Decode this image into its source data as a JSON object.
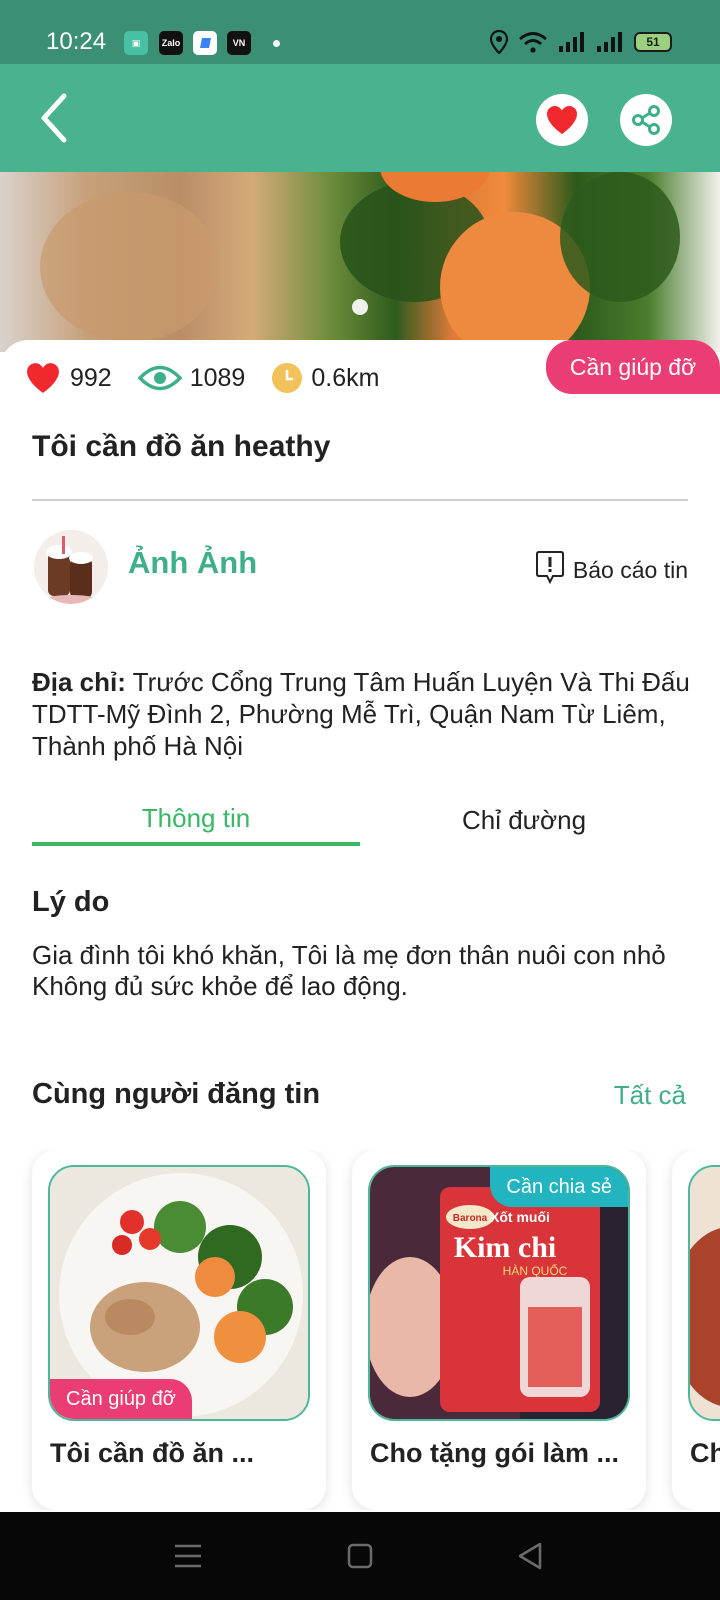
{
  "status_bar": {
    "time": "10:24",
    "notif_icons": [
      "Zalo",
      "VN"
    ],
    "battery": "51"
  },
  "header": {
    "back_icon": "chevron-left-icon",
    "favorite_icon": "heart-icon",
    "share_icon": "share-icon"
  },
  "stats": {
    "likes": "992",
    "views": "1089",
    "distance": "0.6km"
  },
  "post": {
    "status_tag": "Cần giúp đỡ",
    "title": "Tôi cần đồ ăn heathy",
    "author": "Ảnh Ảnh",
    "report_label": "Báo cáo tin",
    "address_label": "Địa chỉ:",
    "address": " Trước Cổng Trung Tâm Huấn Luyện Và Thi Đấu TDTT-Mỹ Đình 2, Phường Mễ Trì, Quận Nam Từ Liêm, Thành phố Hà Nội"
  },
  "tabs": {
    "info": "Thông tin",
    "directions": "Chỉ đường"
  },
  "reason": {
    "heading": "Lý do",
    "line1": "Gia đình tôi khó khăn, Tôi là mẹ đơn thân nuôi con nhỏ",
    "line2": "Không đủ sức khỏe để lao động."
  },
  "related": {
    "heading": "Cùng người đăng tin",
    "see_all": "Tất cả",
    "cards": [
      {
        "title": "Tôi cần đồ ăn ...",
        "tag": "Cần giúp đỡ"
      },
      {
        "title": "Cho tặng gói làm ...",
        "tag": "Cần chia sẻ",
        "pack_brand": "Barona",
        "pack_line1": "Xốt muối",
        "pack_line2": "Kim chi",
        "pack_line3": "HÀN QUỐC"
      },
      {
        "title": "Ch"
      }
    ]
  },
  "colors": {
    "primary_green": "#49b390",
    "tab_green": "#37b865",
    "need_pink": "#ea3d73",
    "share_teal": "#22b5c0"
  }
}
